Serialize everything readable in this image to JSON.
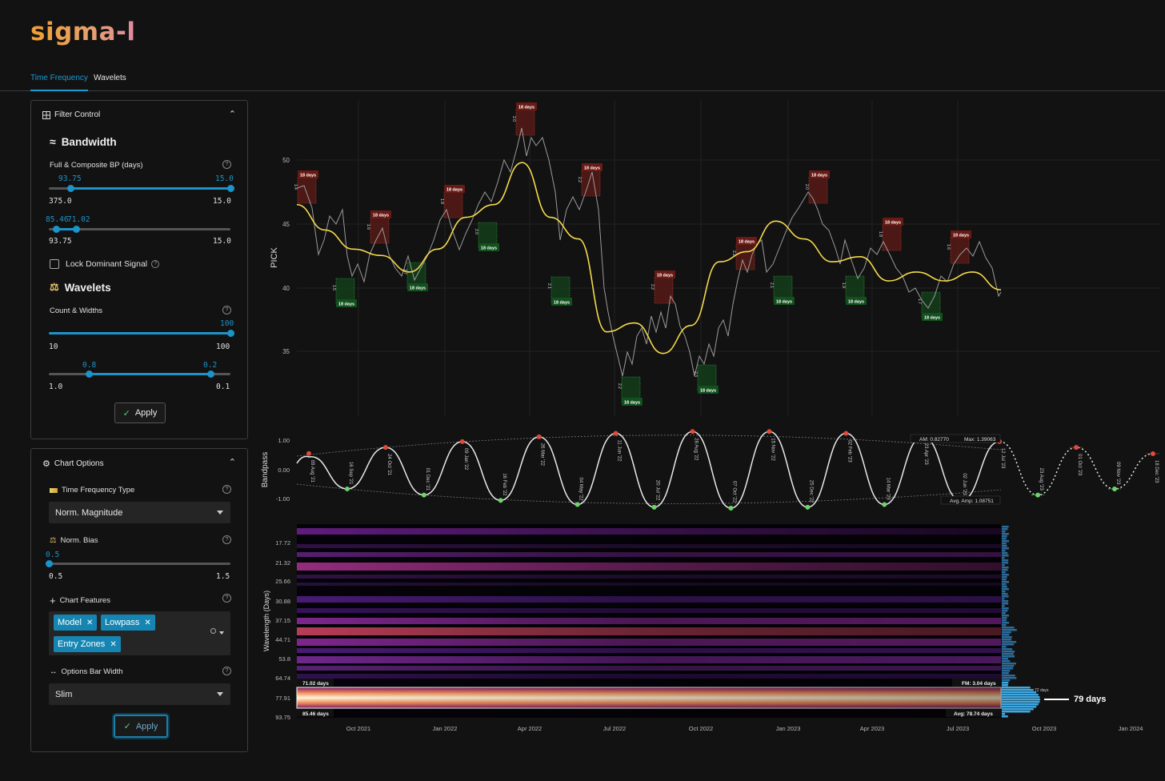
{
  "app": {
    "brand": "sigma-l"
  },
  "tabs": [
    {
      "label": "Time Frequency",
      "active": true
    },
    {
      "label": "Wavelets",
      "active": false
    }
  ],
  "filter_control": {
    "title": "Filter Control",
    "bandwidth": {
      "title": "Bandwidth",
      "label": "Full & Composite BP (days)",
      "slider1": {
        "low": "93.75",
        "high": "15.0",
        "min": "375.0",
        "max": "15.0"
      },
      "slider2": {
        "low": "85.46",
        "high": "71.02",
        "min": "93.75",
        "max": "15.0"
      },
      "lock_label": "Lock Dominant Signal",
      "lock_checked": false
    },
    "wavelets": {
      "title": "Wavelets",
      "label": "Count & Widths",
      "slider1": {
        "value": "100",
        "min": "10",
        "max": "100"
      },
      "slider2": {
        "low": "0.8",
        "high": "0.2",
        "min": "1.0",
        "max": "0.1"
      }
    },
    "apply_label": "Apply"
  },
  "chart_options": {
    "title": "Chart Options",
    "tf_type_label": "Time Frequency Type",
    "tf_type_value": "Norm. Magnitude",
    "norm_bias_label": "Norm. Bias",
    "norm_bias": {
      "value": "0.5",
      "min": "0.5",
      "max": "1.5"
    },
    "features_label": "Chart Features",
    "features": [
      "Model",
      "Lowpass",
      "Entry Zones"
    ],
    "bar_width_label": "Options Bar Width",
    "bar_width_value": "Slim",
    "apply_label": "Apply"
  },
  "chart_data": [
    {
      "type": "line",
      "ylabel": "PICK",
      "y_ticks": [
        "50",
        "45",
        "40",
        "35"
      ],
      "ylim": [
        32,
        54
      ],
      "lowpass_series": {
        "t": [
          0,
          0.04,
          0.08,
          0.12,
          0.16,
          0.2,
          0.24,
          0.28,
          0.32,
          0.36,
          0.4,
          0.44,
          0.48,
          0.52,
          0.56,
          0.6,
          0.64,
          0.68,
          0.72,
          0.76,
          0.8,
          0.84,
          0.88,
          0.92,
          0.96,
          1.0
        ],
        "y": [
          46.5,
          44.5,
          43,
          42.5,
          41.2,
          43,
          45.5,
          46.5,
          49.8,
          45.5,
          43.8,
          36.5,
          37.2,
          34.8,
          37,
          42,
          42.8,
          45.2,
          43.8,
          42,
          42.4,
          40.5,
          41.2,
          40.5,
          41.2,
          39.8
        ]
      },
      "entry_zones": [
        {
          "side": "sell",
          "label": "18 days",
          "rank": "1.4"
        },
        {
          "side": "buy",
          "label": "18 days",
          "rank": "1.5"
        },
        {
          "side": "sell",
          "label": "18 days",
          "rank": "1.6"
        },
        {
          "side": "buy",
          "label": "18 days",
          "rank": "1.7"
        },
        {
          "side": "sell",
          "label": "18 days",
          "rank": "1.8"
        },
        {
          "side": "buy",
          "label": "18 days",
          "rank": "2.0"
        },
        {
          "side": "sell",
          "label": "18 days",
          "rank": "2.0"
        },
        {
          "side": "sell",
          "label": "18 days",
          "rank": "2.2"
        },
        {
          "side": "buy",
          "label": "18 days",
          "rank": "2.1"
        },
        {
          "side": "sell",
          "label": "18 days",
          "rank": "2.2"
        },
        {
          "side": "buy",
          "label": "18 days",
          "rank": "2.2"
        },
        {
          "side": "buy",
          "label": "18 days",
          "rank": "2.3"
        },
        {
          "side": "sell",
          "label": "18 days",
          "rank": "2.2"
        },
        {
          "side": "buy",
          "label": "18 days",
          "rank": "2.1"
        },
        {
          "side": "sell",
          "label": "18 days",
          "rank": "2.0"
        },
        {
          "side": "buy",
          "label": "18 days",
          "rank": "1.9"
        },
        {
          "side": "sell",
          "label": "18 days",
          "rank": "1.8"
        },
        {
          "side": "buy",
          "label": "18 days",
          "rank": "1.7"
        },
        {
          "side": "sell",
          "label": "18 days",
          "rank": "1.6"
        }
      ]
    },
    {
      "type": "line",
      "ylabel": "Bandpass",
      "y_ticks": [
        "1.00",
        "0.00",
        "-1.00"
      ],
      "ylim": [
        -1.3,
        1.3
      ],
      "cycle_labels": [
        "09 Aug '21",
        "16 Sep '21",
        "24 Oct '21",
        "01 Dec '21",
        "09 Jan '22",
        "16 Feb '22",
        "26 Mar '22",
        "04 May '22",
        "11 Jun '22",
        "20 Jul '22",
        "28 Aug '22",
        "07 Oct '22",
        "15 Nov '22",
        "25 Dec '22",
        "02 Feb '23",
        "14 Mar '23",
        "23 Apr '23",
        "02 Jun '23",
        "12 Jul '23",
        "23 Aug '23",
        "01 Oct '23",
        "09 Nov '23",
        "18 Dec '23"
      ],
      "annotations": {
        "am": "AM: 0.82770",
        "max": "Max: 1.39063",
        "avg_amp": "Avg. Amp: 1.08751"
      }
    },
    {
      "type": "heatmap",
      "ylabel": "Wavelength (Days)",
      "y_ticks": [
        "17.72",
        "21.32",
        "25.66",
        "30.88",
        "37.15",
        "44.71",
        "53.8",
        "64.74",
        "77.91",
        "93.75"
      ],
      "x_ticks": [
        "Oct 2021",
        "Jan 2022",
        "Apr 2022",
        "Jul 2022",
        "Oct 2022",
        "Jan 2023",
        "Apr 2023",
        "Jul 2023",
        "Oct 2023",
        "Jan 2024"
      ],
      "band_labels": {
        "top_left": "71.02 days",
        "bottom_left": "85.46 days",
        "top_right": "FM: 3.04 days",
        "bottom_right": "Avg: 78.74 days"
      },
      "peak_label": "79 days",
      "side_label": "72 days"
    }
  ]
}
